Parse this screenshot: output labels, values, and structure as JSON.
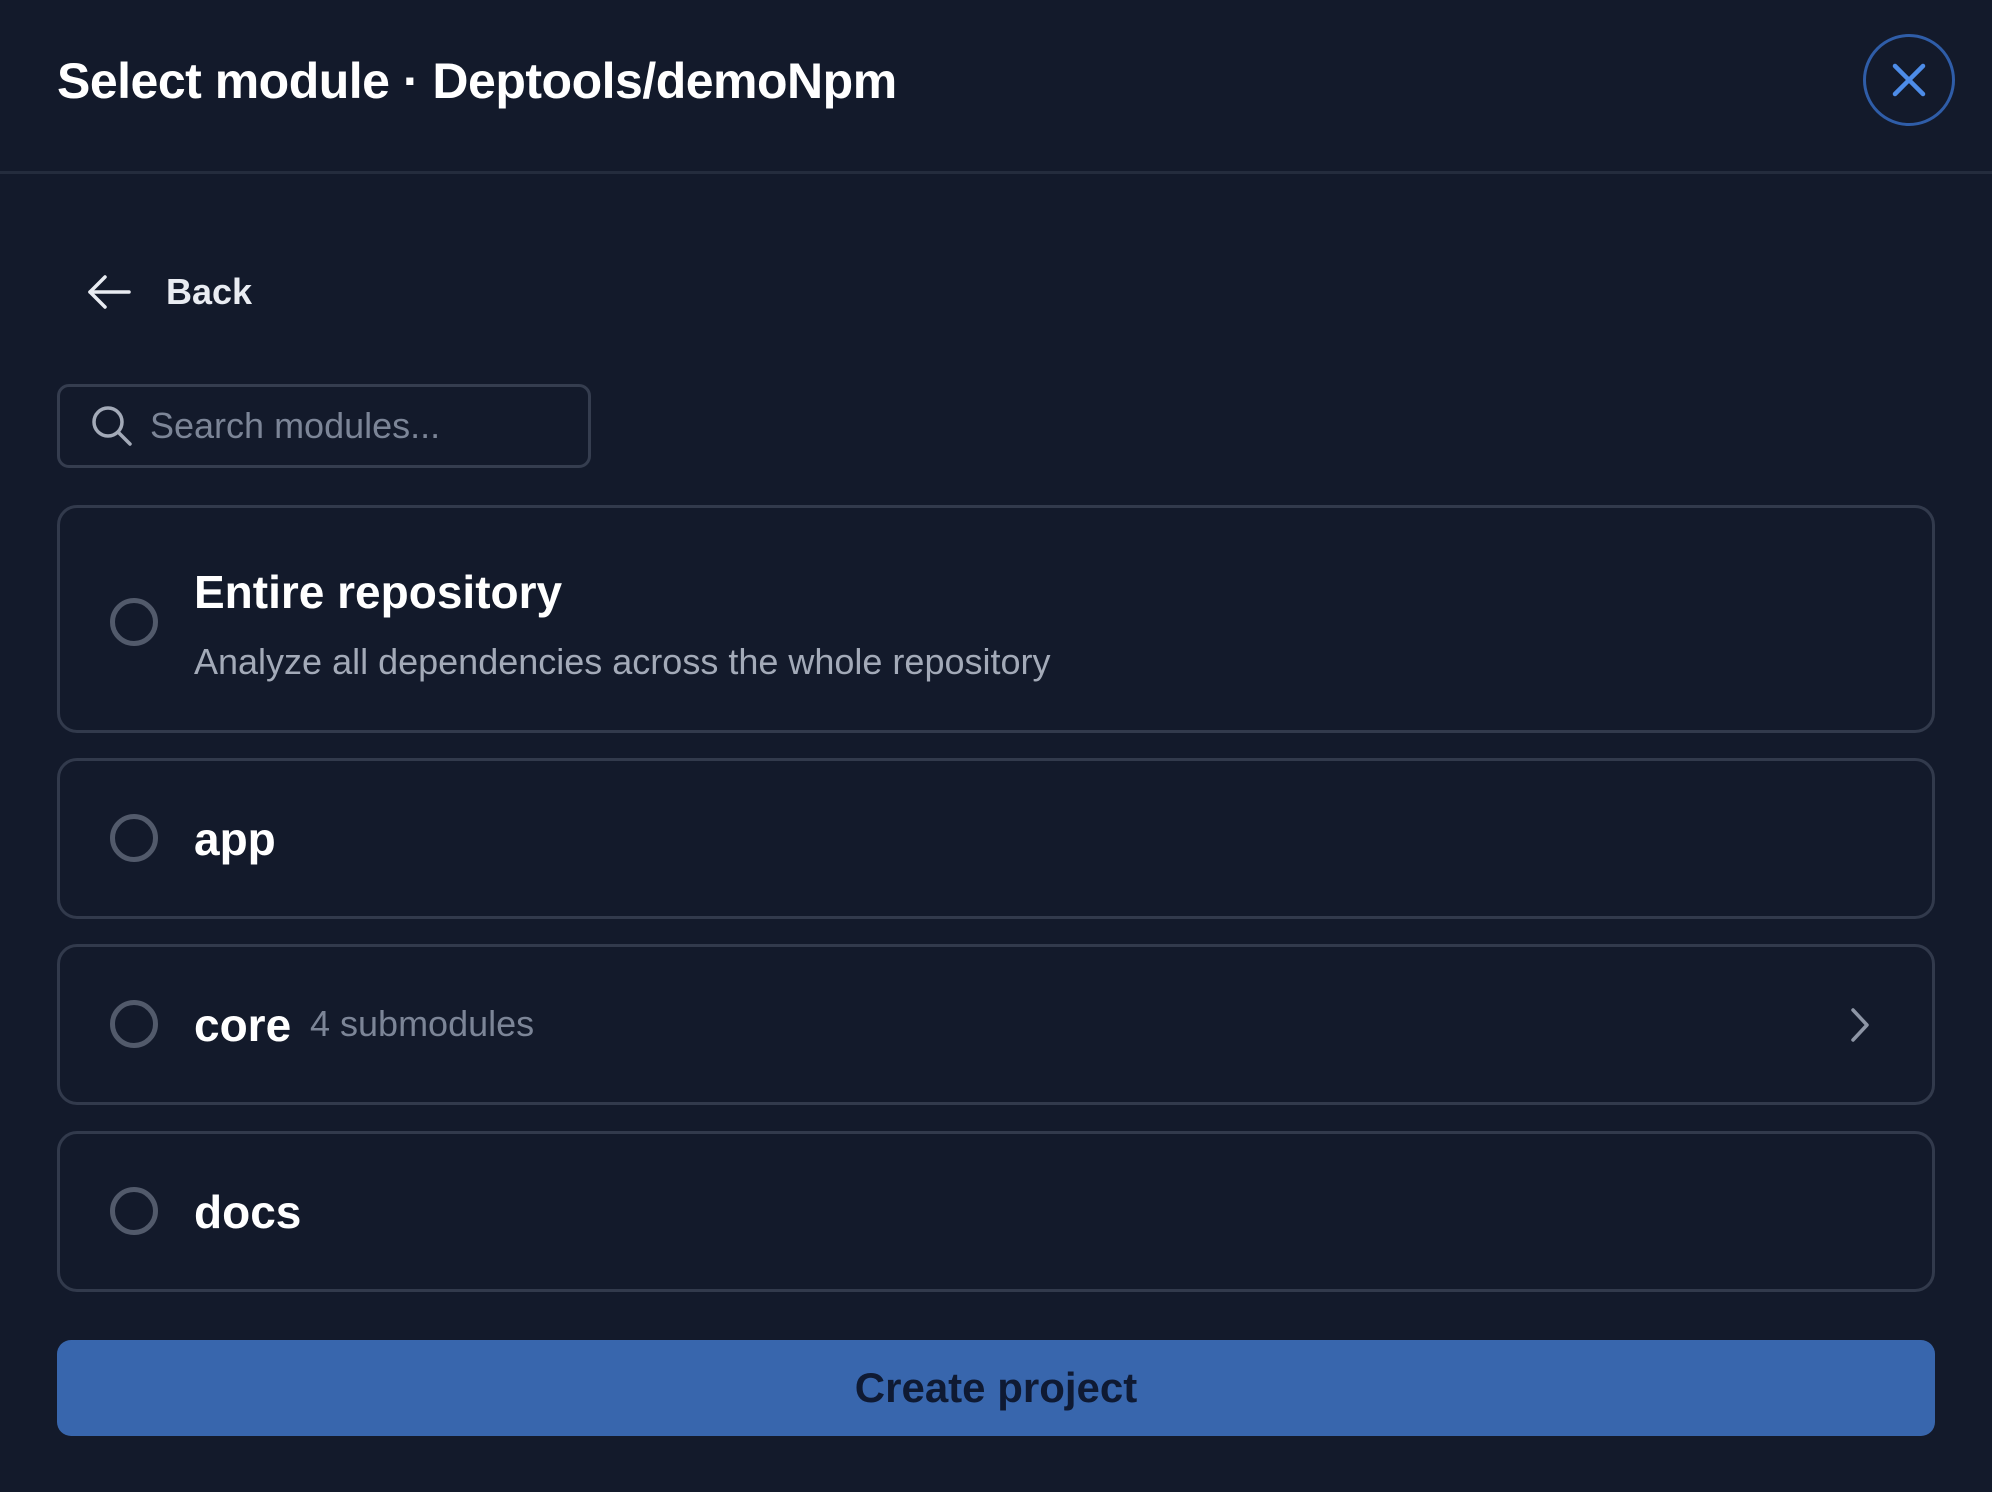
{
  "header": {
    "title": "Select module · Deptools/demoNpm",
    "close_icon": "close-icon"
  },
  "back": {
    "label": "Back",
    "icon": "arrow-left-icon"
  },
  "search": {
    "value": "",
    "placeholder": "Search modules...",
    "icon": "search-icon"
  },
  "options": [
    {
      "title": "Entire repository",
      "description": "Analyze all dependencies across the whole repository",
      "selected": false
    },
    {
      "title": "app",
      "selected": false
    },
    {
      "title": "core",
      "meta": "4 submodules",
      "selected": false,
      "icon": "chevron-right-icon"
    },
    {
      "title": "docs",
      "selected": false
    }
  ],
  "footer": {
    "create_label": "Create project"
  },
  "colors": {
    "background": "#131a2b",
    "accent": "#3866ad",
    "close_ring": "#2f5da8",
    "border": "#323a4c"
  }
}
